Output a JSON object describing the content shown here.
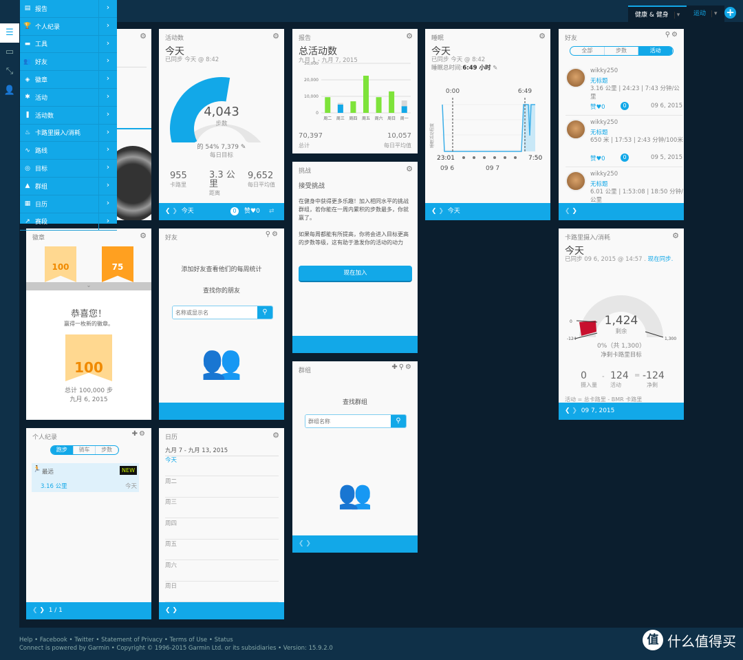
{
  "header": {
    "tabs": [
      {
        "label": "健康 & 健身",
        "active": true
      },
      {
        "label": "运动",
        "active": false
      }
    ],
    "add": "+"
  },
  "rail": [
    "menu-icon",
    "inbox-icon",
    "connections-icon",
    "user-icon"
  ],
  "menu": {
    "items": [
      {
        "label": "报告",
        "icon": "report-icon",
        "g": "▤"
      },
      {
        "label": "个人纪录",
        "icon": "trophy-icon",
        "g": "🏆"
      },
      {
        "label": "工具",
        "icon": "shoe-icon",
        "g": "▬"
      },
      {
        "label": "好友",
        "icon": "friends-icon",
        "g": "👥"
      },
      {
        "label": "徽章",
        "icon": "shield-icon",
        "g": "◈"
      },
      {
        "label": "活动",
        "icon": "activity-icon",
        "g": "✱"
      },
      {
        "label": "活动数",
        "icon": "footsteps-icon",
        "g": "❚"
      },
      {
        "label": "卡路里摄入/消耗",
        "icon": "flame-icon",
        "g": "♨"
      },
      {
        "label": "路线",
        "icon": "route-icon",
        "g": "∿"
      },
      {
        "label": "目标",
        "icon": "target-icon",
        "g": "◎"
      },
      {
        "label": "群组",
        "icon": "groups-icon",
        "g": "▲"
      },
      {
        "label": "日历",
        "icon": "calendar-icon",
        "g": "▦"
      },
      {
        "label": "赛段",
        "icon": "segments-icon",
        "g": "↗"
      }
    ]
  },
  "steps": {
    "title": "活动数",
    "day": "今天",
    "synced": "已同步 今天 @ 8:42",
    "value": "4,043",
    "unit": "步数",
    "progress_percent": 54,
    "goal_text": "的 54% 7,379",
    "goal_label": "每日目标",
    "stats": [
      {
        "v": "955",
        "l": "卡路里"
      },
      {
        "v": "3.3 公里",
        "l": "距离"
      },
      {
        "v": "9,652",
        "l": "每日平均值"
      }
    ],
    "footer_day": "今天",
    "comments": "0",
    "likes": "赞",
    "like_count": "0"
  },
  "report": {
    "title": "报告",
    "heading": "总活动数",
    "range": "九月 1 - 九月 7, 2015",
    "total": "70,397",
    "total_label": "总计",
    "avg": "10,057",
    "avg_label": "每日平均值"
  },
  "chart_data": [
    {
      "type": "bar",
      "categories": [
        "周二",
        "周三",
        "周四",
        "周五",
        "周六",
        "周日",
        "周一"
      ],
      "values": [
        9500,
        5000,
        7000,
        22500,
        9500,
        13000,
        4000
      ],
      "goal": [
        null,
        6000,
        null,
        null,
        null,
        null,
        7500
      ],
      "yticks": [
        "0",
        "10,000",
        "20,000",
        "30,000"
      ],
      "ylim": [
        0,
        30000
      ],
      "colors": {
        "met": "#7ee33a",
        "unmet": "#12a8e8",
        "goal": "#d8d8d8"
      },
      "grid": true
    }
  ],
  "sleep": {
    "title": "睡眠",
    "day": "今天",
    "synced": "已同步 今天 @ 8:42",
    "total_label": "睡眠总时间:",
    "total": "6:49 小时",
    "start": "0:00",
    "end": "6:49",
    "x_start": "23:01",
    "x_end": "7:50",
    "d1": "09 6",
    "d2": "09 7",
    "ylabel": "睡眠活动程度",
    "footer_day": "今天"
  },
  "friends": {
    "title": "好友",
    "tabs": [
      "全部",
      "步数",
      "活动"
    ],
    "items": [
      {
        "name": "wikky250",
        "title": "无标题",
        "stats": "3.16 公里 | 24:23 | 7:43 分钟/公里",
        "like": "赞",
        "lc": "0",
        "cc": "0",
        "date": "09 6, 2015"
      },
      {
        "name": "wikky250",
        "title": "无标题",
        "stats": "650 米 | 17:53 | 2:43 分钟/100米",
        "like": "赞",
        "lc": "0",
        "cc": "0",
        "date": "09 5, 2015"
      },
      {
        "name": "wikky250",
        "title": "无标题",
        "stats": "6.01 公里 | 1:53:08 | 18:50 分钟/公里"
      }
    ]
  },
  "challenge": {
    "title": "挑战",
    "heading": "接受挑战",
    "p1": "在健身中获得更多乐趣！加入相同水平的挑战群组，若你能在一周内累积的步数最多，你就赢了。",
    "p2": "如果每周都能有所提高，你将会进入目标更高的步数等级，这有助于激发你的活动的动力",
    "button": "现在加入"
  },
  "badges": {
    "title": "徽章",
    "b1": "100",
    "b2": "75",
    "congrats": "恭喜您！",
    "won": "赢得一枚新的徽章。",
    "big": "100",
    "total": "总计 100,000 步",
    "date": "九月 6, 2015"
  },
  "friends2": {
    "title": "好友",
    "msg": "添加好友查看他们的每周统计",
    "find": "查找你的朋友",
    "placeholder": "名称或显示名"
  },
  "groups": {
    "title": "群组",
    "find": "查找群组",
    "placeholder": "群组名称"
  },
  "calories": {
    "title": "卡路里摄入/消耗",
    "day": "今天",
    "synced": "已同步 09 6, 2015 @ 14:57 .",
    "sync_now": "现在同步.",
    "value": "1,424",
    "remain": "剩余",
    "pct": "0%（共 1,300）",
    "goal_label": "净剩卡路里目标",
    "min": "-124",
    "zero": "0",
    "max": "1,300",
    "in": "0",
    "in_l": "摄入量",
    "act": "124",
    "act_l": "活动",
    "net": "-124",
    "net_l": "净剩",
    "minus": "-",
    "eq": "=",
    "formula": "活动 = 总卡路里 - BMR 卡路里",
    "footer_date": "09 7, 2015"
  },
  "pr": {
    "title": "个人纪录",
    "tabs": [
      "跑步",
      "骑车",
      "步数"
    ],
    "label": "最远",
    "badge": "NEW",
    "value": "3.16 公里",
    "when": "今天",
    "page": "1 / 1"
  },
  "calendar": {
    "title": "日历",
    "range": "九月 7 - 九月 13, 2015",
    "days": [
      "今天",
      "周二",
      "周三",
      "周四",
      "周五",
      "周六",
      "周日"
    ]
  },
  "footer": {
    "links": [
      "Help",
      "Facebook",
      "Twitter",
      "Statement of Privacy",
      "Terms of Use",
      "Status"
    ],
    "copy": "Connect is powered by Garmin • Copyright © 1996-2015 Garmin Ltd. or its subsidiaries • Version: 15.9.2.0"
  },
  "watermark": "什么值得买"
}
